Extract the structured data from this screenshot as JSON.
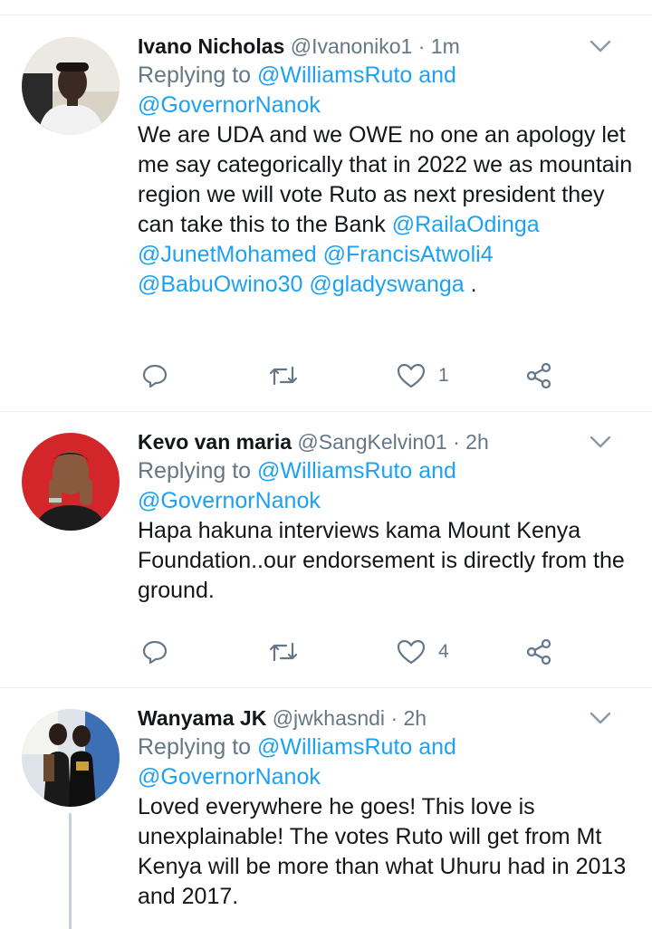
{
  "tweets": [
    {
      "name": "Ivano Nicholas",
      "handle": "@Ivanoniko1",
      "dot": "·",
      "time": "1m",
      "replying_prefix": "Replying to",
      "replying_user1": "@WilliamsRuto",
      "replying_and": "and",
      "replying_user2": "@GovernorNanok",
      "text": "We are UDA and we OWE no one an apology let me say categorically that in 2022 we as mountain region we will vote Ruto as next president they can take this to the Bank",
      "mentions": [
        "@RailaOdinga",
        "@JunetMohamed",
        "@FrancisAtwoli4",
        "@BabuOwino30",
        "@gladyswanga"
      ],
      "trailing": ".",
      "likes": "1"
    },
    {
      "name": "Kevo van maria",
      "handle": "@SangKelvin01",
      "dot": "·",
      "time": "2h",
      "replying_prefix": "Replying to",
      "replying_user1": "@WilliamsRuto",
      "replying_and": "and",
      "replying_user2": "@GovernorNanok",
      "text": "Hapa hakuna interviews kama Mount Kenya Foundation..our endorsement is directly from the ground.",
      "likes": "4"
    },
    {
      "name": "Wanyama JK",
      "handle": "@jwkhasndi",
      "dot": "·",
      "time": "2h",
      "replying_prefix": "Replying to",
      "replying_user1": "@WilliamsRuto",
      "replying_and": "and",
      "replying_user2": "@GovernorNanok",
      "text": "Loved everywhere he goes! This love is unexplainable!  The votes Ruto will get from Mt Kenya will be more than what Uhuru had in 2013 and 2017."
    }
  ],
  "colors": {
    "link": "#1da1f2",
    "secondary": "#657786",
    "text": "#14171a",
    "divider": "#e6ecf0"
  },
  "icons": [
    "reply-icon",
    "retweet-icon",
    "like-icon",
    "share-icon",
    "chevron-down-icon"
  ]
}
